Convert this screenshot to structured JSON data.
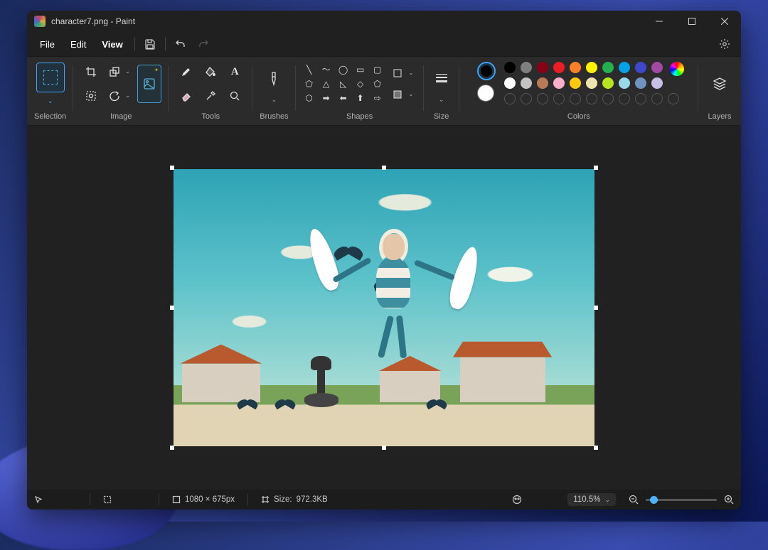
{
  "title": "character7.png - Paint",
  "menus": {
    "file": "File",
    "edit": "Edit",
    "view": "View"
  },
  "ribbon": {
    "selection": "Selection",
    "image": "Image",
    "tools": "Tools",
    "brushes": "Brushes",
    "shapes": "Shapes",
    "size": "Size",
    "colors": "Colors",
    "layers": "Layers"
  },
  "colors": {
    "primary": "#000000",
    "secondary": "#ffffff",
    "row1": [
      "#000000",
      "#7f7f7f",
      "#880015",
      "#ed1c24",
      "#ff7f27",
      "#fff200",
      "#22b14c",
      "#00a2e8",
      "#3f48cc",
      "#a349a4"
    ],
    "row2": [
      "#ffffff",
      "#c3c3c3",
      "#b97a57",
      "#ffaec9",
      "#ffc90e",
      "#efe4b0",
      "#b5e61d",
      "#99d9ea",
      "#7092be",
      "#c8bfe7"
    ]
  },
  "status": {
    "dimensions": "1080 × 675px",
    "size_label": "Size:",
    "size_value": "972.3KB",
    "zoom": "110.5%"
  }
}
